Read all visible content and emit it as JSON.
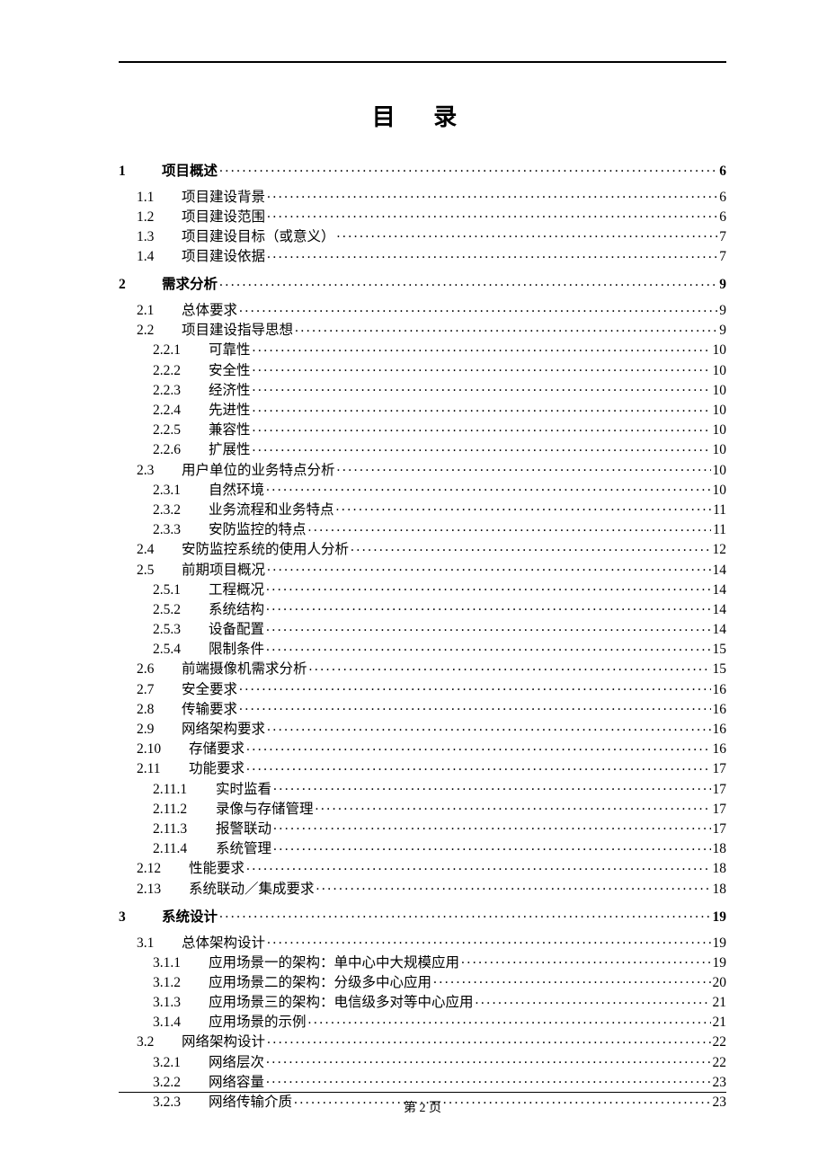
{
  "title": "目 录",
  "footer_prefix": "第 ",
  "footer_page": "2",
  "footer_suffix": " 页",
  "toc": [
    {
      "lvl": 1,
      "num": "1",
      "text": "项目概述",
      "page": "6"
    },
    {
      "lvl": 2,
      "num": "1.1",
      "text": "项目建设背景",
      "page": "6"
    },
    {
      "lvl": 2,
      "num": "1.2",
      "text": "项目建设范围",
      "page": "6"
    },
    {
      "lvl": 2,
      "num": "1.3",
      "text": "项目建设目标（或意义）",
      "page": "7"
    },
    {
      "lvl": 2,
      "num": "1.4",
      "text": "项目建设依据",
      "page": "7"
    },
    {
      "lvl": 1,
      "num": "2",
      "text": "需求分析",
      "page": "9"
    },
    {
      "lvl": 2,
      "num": "2.1",
      "text": "总体要求",
      "page": "9"
    },
    {
      "lvl": 2,
      "num": "2.2",
      "text": "项目建设指导思想",
      "page": "9"
    },
    {
      "lvl": 3,
      "num": "2.2.1",
      "text": "可靠性",
      "page": "10"
    },
    {
      "lvl": 3,
      "num": "2.2.2",
      "text": "安全性",
      "page": "10"
    },
    {
      "lvl": 3,
      "num": "2.2.3",
      "text": "经济性",
      "page": "10"
    },
    {
      "lvl": 3,
      "num": "2.2.4",
      "text": "先进性",
      "page": "10"
    },
    {
      "lvl": 3,
      "num": "2.2.5",
      "text": "兼容性",
      "page": "10"
    },
    {
      "lvl": 3,
      "num": "2.2.6",
      "text": "扩展性",
      "page": "10"
    },
    {
      "lvl": 2,
      "num": "2.3",
      "text": "用户单位的业务特点分析",
      "page": "10"
    },
    {
      "lvl": 3,
      "num": "2.3.1",
      "text": "自然环境",
      "page": "10"
    },
    {
      "lvl": 3,
      "num": "2.3.2",
      "text": "业务流程和业务特点",
      "page": "11"
    },
    {
      "lvl": 3,
      "num": "2.3.3",
      "text": "安防监控的特点",
      "page": "11"
    },
    {
      "lvl": 2,
      "num": "2.4",
      "text": "安防监控系统的使用人分析",
      "page": "12"
    },
    {
      "lvl": 2,
      "num": "2.5",
      "text": "前期项目概况",
      "page": "14"
    },
    {
      "lvl": 3,
      "num": "2.5.1",
      "text": "工程概况",
      "page": "14"
    },
    {
      "lvl": 3,
      "num": "2.5.2",
      "text": "系统结构",
      "page": "14"
    },
    {
      "lvl": 3,
      "num": "2.5.3",
      "text": "设备配置",
      "page": "14"
    },
    {
      "lvl": 3,
      "num": "2.5.4",
      "text": "限制条件",
      "page": "15"
    },
    {
      "lvl": 2,
      "num": "2.6",
      "text": "前端摄像机需求分析",
      "page": "15"
    },
    {
      "lvl": 2,
      "num": "2.7",
      "text": "安全要求",
      "page": "16"
    },
    {
      "lvl": 2,
      "num": "2.8",
      "text": "传输要求",
      "page": "16"
    },
    {
      "lvl": 2,
      "num": "2.9",
      "text": "网络架构要求",
      "page": "16"
    },
    {
      "lvl": 2,
      "num": "2.10",
      "text": "存储要求",
      "page": "16",
      "wide": true
    },
    {
      "lvl": 2,
      "num": "2.11",
      "text": "功能要求",
      "page": "17",
      "wide": true
    },
    {
      "lvl": 3,
      "num": "2.11.1",
      "text": "实时监看",
      "page": "17",
      "wide": true
    },
    {
      "lvl": 3,
      "num": "2.11.2",
      "text": "录像与存储管理",
      "page": "17",
      "wide": true
    },
    {
      "lvl": 3,
      "num": "2.11.3",
      "text": "报警联动",
      "page": "17",
      "wide": true
    },
    {
      "lvl": 3,
      "num": "2.11.4",
      "text": "系统管理",
      "page": "18",
      "wide": true
    },
    {
      "lvl": 2,
      "num": "2.12",
      "text": "性能要求",
      "page": "18",
      "wide": true
    },
    {
      "lvl": 2,
      "num": "2.13",
      "text": "系统联动／集成要求",
      "page": "18",
      "wide": true
    },
    {
      "lvl": 1,
      "num": "3",
      "text": "系统设计",
      "page": "19"
    },
    {
      "lvl": 2,
      "num": "3.1",
      "text": "总体架构设计",
      "page": "19"
    },
    {
      "lvl": 3,
      "num": "3.1.1",
      "text": "应用场景一的架构：单中心中大规模应用",
      "page": "19"
    },
    {
      "lvl": 3,
      "num": "3.1.2",
      "text": "应用场景二的架构：分级多中心应用",
      "page": "20"
    },
    {
      "lvl": 3,
      "num": "3.1.3",
      "text": "应用场景三的架构：电信级多对等中心应用",
      "page": "21"
    },
    {
      "lvl": 3,
      "num": "3.1.4",
      "text": "应用场景的示例",
      "page": "21"
    },
    {
      "lvl": 2,
      "num": "3.2",
      "text": "网络架构设计",
      "page": "22"
    },
    {
      "lvl": 3,
      "num": "3.2.1",
      "text": "网络层次",
      "page": "22"
    },
    {
      "lvl": 3,
      "num": "3.2.2",
      "text": "网络容量",
      "page": "23"
    },
    {
      "lvl": 3,
      "num": "3.2.3",
      "text": "网络传输介质",
      "page": "23"
    }
  ]
}
